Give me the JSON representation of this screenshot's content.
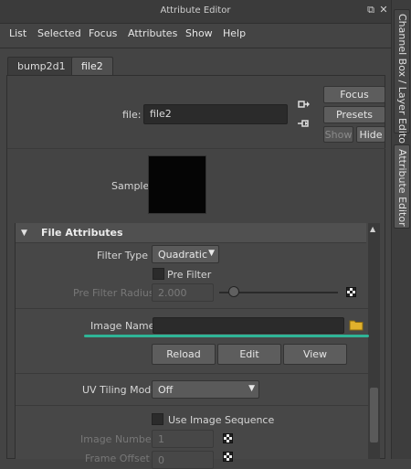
{
  "window": {
    "title": "Attribute Editor",
    "restore_glyph": "⧉",
    "close_glyph": "✕"
  },
  "menu": [
    "List",
    "Selected",
    "Focus",
    "Attributes",
    "Show",
    "Help"
  ],
  "tabs": [
    {
      "label": "bump2d1",
      "active": false
    },
    {
      "label": "file2",
      "active": true
    }
  ],
  "node": {
    "file_label": "file:",
    "file_value": "file2",
    "buttons": {
      "focus": "Focus",
      "presets": "Presets",
      "show": "Show",
      "hide": "Hide"
    },
    "sample_label": "Sample"
  },
  "section": {
    "title": "File Attributes",
    "filter_type_label": "Filter Type",
    "filter_type_value": "Quadratic",
    "pre_filter_label": "Pre Filter",
    "pre_filter_radius_label": "Pre Filter Radius",
    "pre_filter_radius_value": "2.000",
    "image_name_label": "Image Name",
    "image_name_value": "",
    "reload_label": "Reload",
    "edit_label": "Edit",
    "view_label": "View",
    "uv_tiling_label": "UV Tiling Mode",
    "uv_tiling_value": "Off",
    "use_image_sequence_label": "Use Image Sequence",
    "image_number_label": "Image Number",
    "image_number_value": "1",
    "frame_offset_label": "Frame Offset",
    "frame_offset_value": "0"
  },
  "side_tabs": [
    {
      "label": "Channel Box / Layer Editor",
      "active": false
    },
    {
      "label": "Attribute Editor",
      "active": true
    }
  ],
  "colors": {
    "background": "#444444",
    "highlight_underline": "#2fb597",
    "folder_icon": "#e1b12c"
  },
  "icons": {
    "collapse": "▼",
    "dropdown_arrow": "▼",
    "scroll_up": "▲",
    "input_connections": "input-connections-icon",
    "output_connections": "output-connections-icon",
    "folder": "folder-icon",
    "checker_map": "checker-map-icon"
  }
}
